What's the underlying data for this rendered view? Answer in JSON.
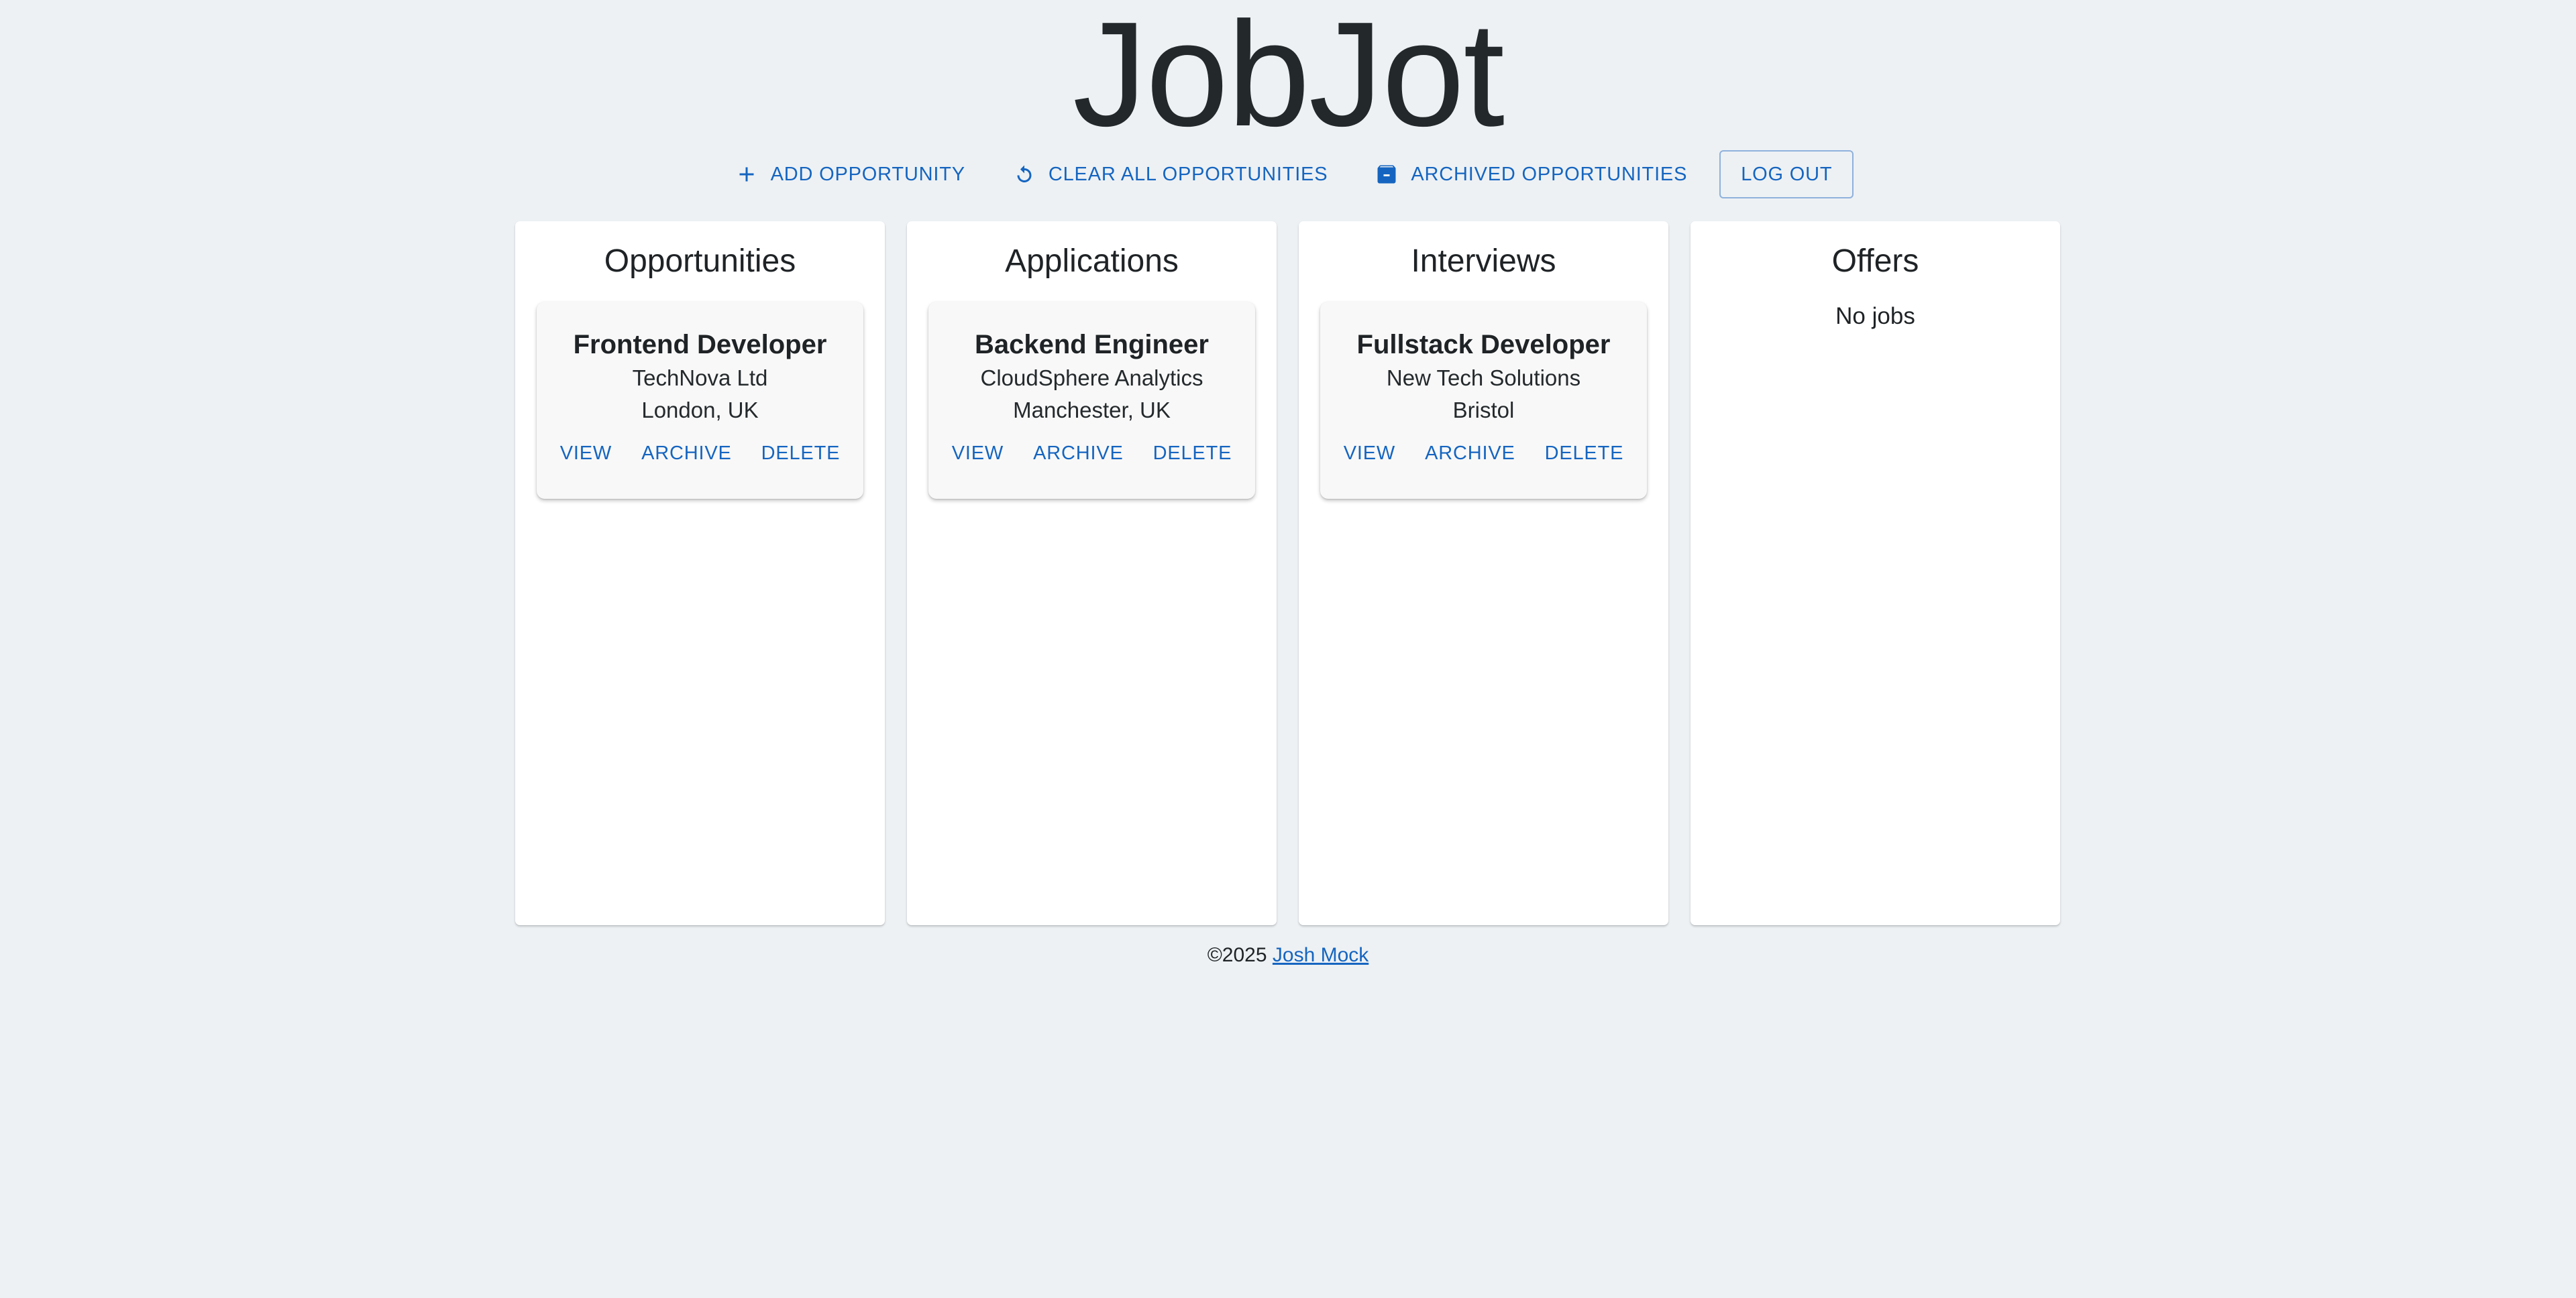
{
  "app": {
    "title": "JobJot"
  },
  "toolbar": {
    "add_label": "ADD OPPORTUNITY",
    "clear_label": "CLEAR ALL OPPORTUNITIES",
    "archived_label": "ARCHIVED OPPORTUNITIES",
    "logout_label": "LOG OUT",
    "accent": "#1565c0"
  },
  "columns": [
    {
      "title": "Opportunities",
      "job": {
        "title": "Frontend Developer",
        "company": "TechNova Ltd",
        "location": "London, UK"
      },
      "actions": {
        "view": "VIEW",
        "archive": "ARCHIVE",
        "delete": "DELETE"
      }
    },
    {
      "title": "Applications",
      "job": {
        "title": "Backend Engineer",
        "company": "CloudSphere Analytics",
        "location": "Manchester, UK"
      },
      "actions": {
        "view": "VIEW",
        "archive": "ARCHIVE",
        "delete": "DELETE"
      }
    },
    {
      "title": "Interviews",
      "job": {
        "title": "Fullstack Developer",
        "company": "New Tech Solutions",
        "location": "Bristol"
      },
      "actions": {
        "view": "VIEW",
        "archive": "ARCHIVE",
        "delete": "DELETE"
      }
    },
    {
      "title": "Offers",
      "empty_text": "No jobs"
    }
  ],
  "footer": {
    "copyright": "©2025",
    "author": "Josh Mock"
  },
  "icons": {
    "add": "plus-icon",
    "clear": "refresh-icon",
    "archived": "archive-box-icon"
  },
  "colors": {
    "background": "#edf1f4",
    "accent": "#1565c0",
    "card": "#f8f8f8"
  }
}
